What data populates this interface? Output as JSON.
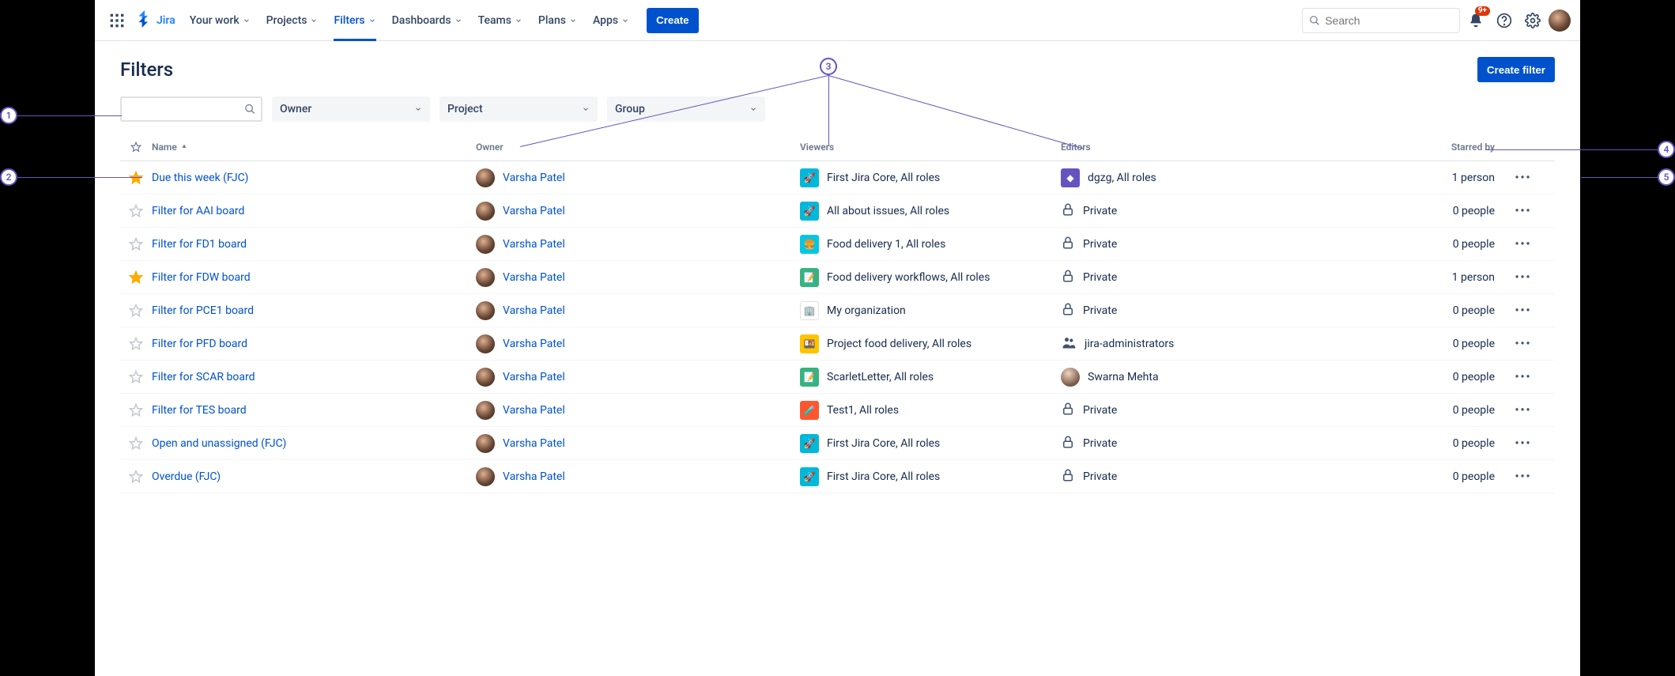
{
  "topnav": {
    "product": "Jira",
    "items": [
      {
        "label": "Your work"
      },
      {
        "label": "Projects"
      },
      {
        "label": "Filters",
        "active": true
      },
      {
        "label": "Dashboards"
      },
      {
        "label": "Teams"
      },
      {
        "label": "Plans"
      },
      {
        "label": "Apps"
      }
    ],
    "create_label": "Create",
    "search_placeholder": "Search",
    "notification_badge": "9+"
  },
  "page": {
    "title": "Filters",
    "create_filter_label": "Create filter",
    "dropdowns": {
      "owner": "Owner",
      "project": "Project",
      "group": "Group"
    }
  },
  "columns": {
    "name": "Name",
    "owner": "Owner",
    "viewers": "Viewers",
    "editors": "Editors",
    "starred": "Starred by"
  },
  "rows": [
    {
      "starred": true,
      "name": "Due this week (FJC)",
      "owner": "Varsha Patel",
      "viewer_icon": {
        "bg": "#00B8D9",
        "glyph": "🚀"
      },
      "viewers": "First Jira Core, All roles",
      "editor_mode": "icon",
      "editor_icon": {
        "bg": "#6554C0",
        "glyph": "◆"
      },
      "editors": "dgzg, All roles",
      "starred_by": "1 person"
    },
    {
      "starred": false,
      "name": "Filter for AAI board",
      "owner": "Varsha Patel",
      "viewer_icon": {
        "bg": "#00B8D9",
        "glyph": "🚀"
      },
      "viewers": "All about issues, All roles",
      "editor_mode": "private",
      "editors": "Private",
      "starred_by": "0 people"
    },
    {
      "starred": false,
      "name": "Filter for FD1 board",
      "owner": "Varsha Patel",
      "viewer_icon": {
        "bg": "#00C7E6",
        "glyph": "🍔"
      },
      "viewers": "Food delivery 1, All roles",
      "editor_mode": "private",
      "editors": "Private",
      "starred_by": "0 people"
    },
    {
      "starred": true,
      "name": "Filter for FDW board",
      "owner": "Varsha Patel",
      "viewer_icon": {
        "bg": "#36B37E",
        "glyph": "📝"
      },
      "viewers": "Food delivery workflows, All roles",
      "editor_mode": "private",
      "editors": "Private",
      "starred_by": "1 person"
    },
    {
      "starred": false,
      "name": "Filter for PCE1 board",
      "owner": "Varsha Patel",
      "viewer_icon": {
        "bg": "#ffffff",
        "glyph": "🏢",
        "fg": "#344563",
        "border": true
      },
      "viewers": "My organization",
      "editor_mode": "private",
      "editors": "Private",
      "starred_by": "0 people"
    },
    {
      "starred": false,
      "name": "Filter for PFD board",
      "owner": "Varsha Patel",
      "viewer_icon": {
        "bg": "#FFC400",
        "glyph": "🍱"
      },
      "viewers": "Project food delivery, All roles",
      "editor_mode": "group",
      "editors": "jira-administrators",
      "starred_by": "0 people"
    },
    {
      "starred": false,
      "name": "Filter for SCAR board",
      "owner": "Varsha Patel",
      "viewer_icon": {
        "bg": "#36B37E",
        "glyph": "📝"
      },
      "viewers": "ScarletLetter, All roles",
      "editor_mode": "user",
      "editors": "Swarna Mehta",
      "starred_by": "0 people"
    },
    {
      "starred": false,
      "name": "Filter for TES board",
      "owner": "Varsha Patel",
      "viewer_icon": {
        "bg": "#FF5630",
        "glyph": "🧪"
      },
      "viewers": "Test1, All roles",
      "editor_mode": "private",
      "editors": "Private",
      "starred_by": "0 people"
    },
    {
      "starred": false,
      "name": "Open and unassigned (FJC)",
      "owner": "Varsha Patel",
      "viewer_icon": {
        "bg": "#00B8D9",
        "glyph": "🚀"
      },
      "viewers": "First Jira Core, All roles",
      "editor_mode": "private",
      "editors": "Private",
      "starred_by": "0 people"
    },
    {
      "starred": false,
      "name": "Overdue (FJC)",
      "owner": "Varsha Patel",
      "viewer_icon": {
        "bg": "#00B8D9",
        "glyph": "🚀"
      },
      "viewers": "First Jira Core, All roles",
      "editor_mode": "private",
      "editors": "Private",
      "starred_by": "0 people"
    }
  ],
  "callouts": [
    "1",
    "2",
    "3",
    "4",
    "5"
  ]
}
